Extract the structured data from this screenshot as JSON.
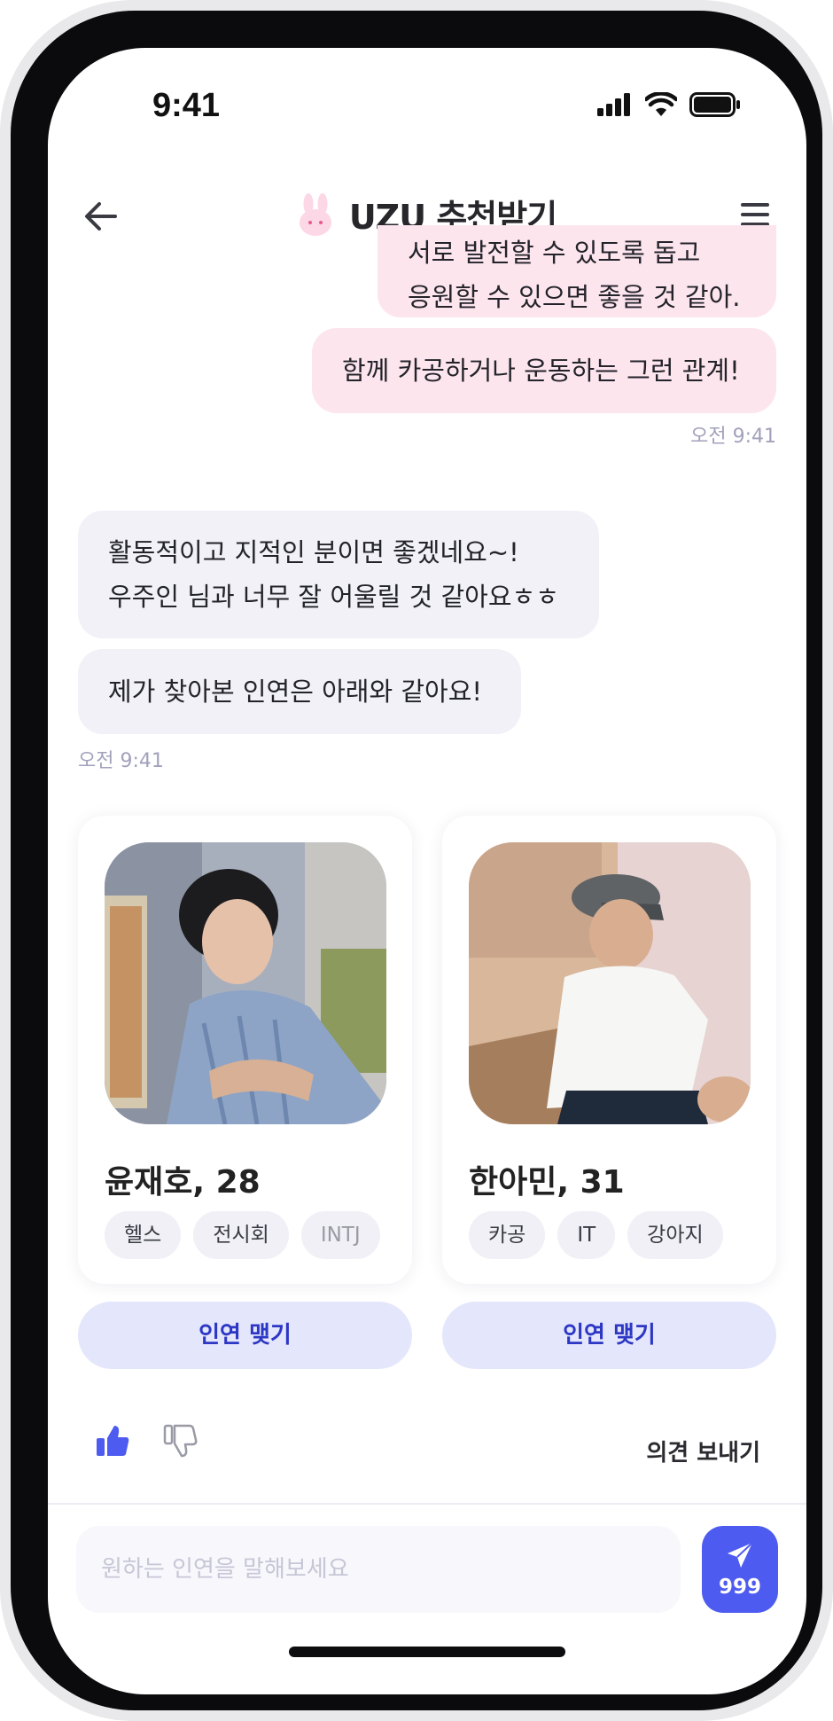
{
  "status_bar": {
    "time": "9:41"
  },
  "header": {
    "title": "UZU 추천받기",
    "logo_icon": "bunny-icon",
    "back_icon": "arrow-left-icon",
    "menu_icon": "hamburger-menu-icon"
  },
  "messages": [
    {
      "sender": "me",
      "lines": [
        "서로 발전할 수 있도록 돕고",
        "응원할 수 있으면 좋을 것 같아."
      ]
    },
    {
      "sender": "me",
      "lines": [
        "함께 카공하거나 운동하는 그런 관계!"
      ],
      "time": "오전 9:41"
    },
    {
      "sender": "bot",
      "lines": [
        "활동적이고 지적인 분이면 좋겠네요~!",
        "우주인 님과 너무 잘 어울릴 것 같아요ㅎㅎ"
      ]
    },
    {
      "sender": "bot",
      "lines": [
        "제가 찾아본 인연은 아래와 같아요!"
      ],
      "time": "오전 9:41"
    }
  ],
  "recommendations": [
    {
      "name": "윤재호, 28",
      "tags": [
        "헬스",
        "전시회",
        "INTJ"
      ],
      "button": "인연 맺기"
    },
    {
      "name": "한아민, 31",
      "tags": [
        "카공",
        "IT",
        "강아지"
      ],
      "button": "인연 맺기"
    }
  ],
  "feedback": {
    "like_icon": "thumbs-up-icon",
    "dislike_icon": "thumbs-down-icon",
    "send_label": "의견 보내기"
  },
  "composer": {
    "placeholder": "원하는 인연을 말해보세요",
    "send_icon": "paper-plane-icon",
    "count": "999"
  },
  "colors": {
    "accent": "#4d5bf0",
    "my_bubble": "#fde5ee",
    "bot_bubble": "#f1f1f7",
    "match_button": "#e4e6fc"
  }
}
